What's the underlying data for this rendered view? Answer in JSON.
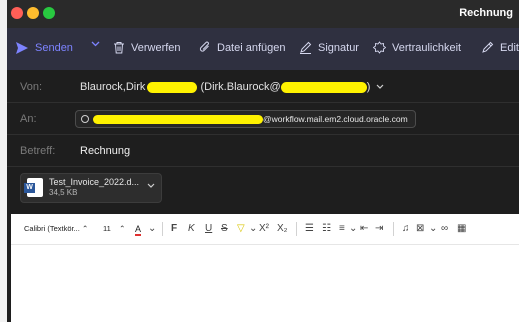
{
  "window": {
    "title": "Rechnung"
  },
  "toolbar": {
    "send": "Senden",
    "discard": "Verwerfen",
    "attach": "Datei anfügen",
    "signature": "Signatur",
    "confidentiality": "Vertraulichkeit",
    "editor": "Edito"
  },
  "from": {
    "label": "Von:",
    "name_prefix": "Blaurock,Dirk",
    "email_prefix": "(Dirk.Blaurock@",
    "email_suffix": ")"
  },
  "to": {
    "label": "An:",
    "recipient_suffix": "@workflow.mail.em2.cloud.oracle.com"
  },
  "subject": {
    "label": "Betreff:",
    "value": "Rechnung"
  },
  "attachment": {
    "name": "Test_Invoice_2022.d...",
    "size": "34,5 KB"
  },
  "format": {
    "font": "Calibri (Textkör...",
    "size": "11"
  },
  "colors": {
    "accent": "#7d83ff",
    "redaction": "#fff200",
    "word": "#2b579a"
  }
}
